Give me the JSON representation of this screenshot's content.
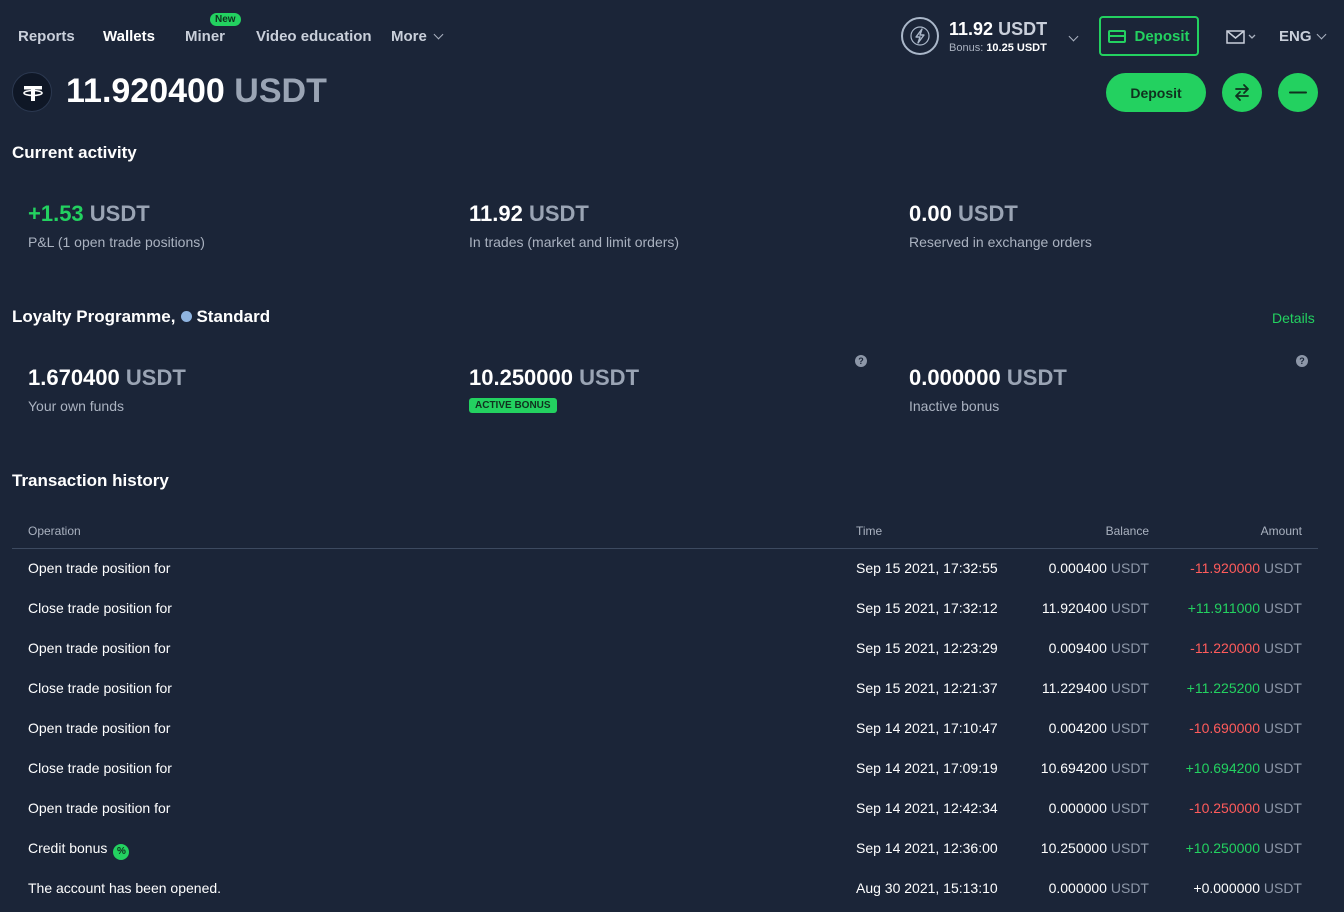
{
  "nav": {
    "items": [
      "Reports",
      "Wallets",
      "Miner",
      "Video education",
      "More"
    ],
    "new_badge": "New"
  },
  "account": {
    "amount": "11.92",
    "currency": "USDT",
    "bonus_label": "Bonus:",
    "bonus_amount": "10.25 USDT",
    "deposit_label": "Deposit",
    "language": "ENG"
  },
  "wallet": {
    "balance": "11.920400",
    "currency": "USDT",
    "deposit_label": "Deposit"
  },
  "current_activity": {
    "title": "Current activity",
    "stats": [
      {
        "value": "+1.53",
        "currency": "USDT",
        "label": "P&L (1 open trade positions)"
      },
      {
        "value": "11.92",
        "currency": "USDT",
        "label": "In trades (market and limit orders)"
      },
      {
        "value": "0.00",
        "currency": "USDT",
        "label": "Reserved in exchange orders"
      }
    ]
  },
  "loyalty": {
    "title": "Loyalty Programme,",
    "level": "Standard",
    "details_label": "Details",
    "help_glyph": "?",
    "stats": [
      {
        "value": "1.670400",
        "currency": "USDT",
        "label": "Your own funds"
      },
      {
        "value": "10.250000",
        "currency": "USDT",
        "badge": "ACTIVE BONUS"
      },
      {
        "value": "0.000000",
        "currency": "USDT",
        "label": "Inactive bonus"
      }
    ]
  },
  "history": {
    "title": "Transaction history",
    "columns": [
      "Operation",
      "Time",
      "Balance",
      "Amount"
    ],
    "rows": [
      {
        "op": "Open trade position for",
        "time": "Sep 15 2021, 17:32:55",
        "balance": "0.000400",
        "amount": "-11.920000",
        "sign": "neg"
      },
      {
        "op": "Close trade position for",
        "time": "Sep 15 2021, 17:32:12",
        "balance": "11.920400",
        "amount": "+11.911000",
        "sign": "pos"
      },
      {
        "op": "Open trade position for",
        "time": "Sep 15 2021, 12:23:29",
        "balance": "0.009400",
        "amount": "-11.220000",
        "sign": "neg"
      },
      {
        "op": "Close trade position for",
        "time": "Sep 15 2021, 12:21:37",
        "balance": "11.229400",
        "amount": "+11.225200",
        "sign": "pos"
      },
      {
        "op": "Open trade position for",
        "time": "Sep 14 2021, 17:10:47",
        "balance": "0.004200",
        "amount": "-10.690000",
        "sign": "neg"
      },
      {
        "op": "Close trade position for",
        "time": "Sep 14 2021, 17:09:19",
        "balance": "10.694200",
        "amount": "+10.694200",
        "sign": "pos"
      },
      {
        "op": "Open trade position for",
        "time": "Sep 14 2021, 12:42:34",
        "balance": "0.000000",
        "amount": "-10.250000",
        "sign": "neg"
      },
      {
        "op": "Credit bonus",
        "time": "Sep 14 2021, 12:36:00",
        "balance": "10.250000",
        "amount": "+10.250000",
        "sign": "pos",
        "bonus_icon": "%"
      },
      {
        "op": "The account has been opened.",
        "time": "Aug 30 2021, 15:13:10",
        "balance": "0.000000",
        "amount": "+0.000000",
        "sign": "zero"
      }
    ],
    "currency": "USDT"
  },
  "colors": {
    "accent": "#23d160",
    "negative": "#ff5b5b",
    "background": "#1b2538"
  }
}
